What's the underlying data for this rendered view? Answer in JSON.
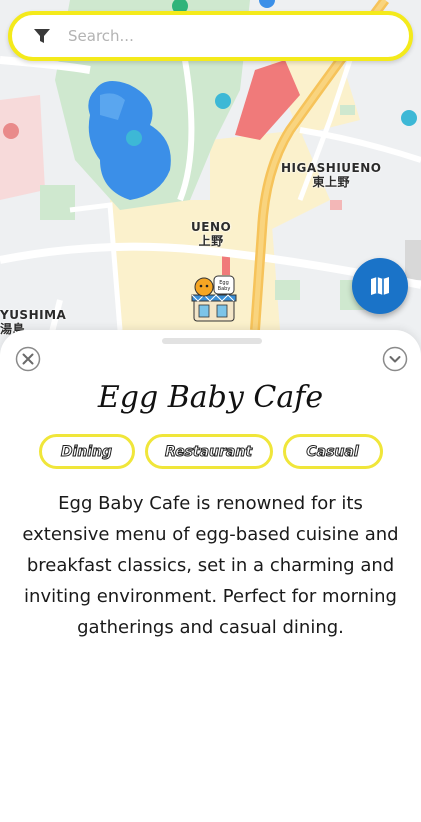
{
  "search": {
    "placeholder": "Search..."
  },
  "map": {
    "labels": {
      "higashiueno_en": "HIGASHIUENO",
      "higashiueno_jp": "東上野",
      "ueno_en": "UENO",
      "ueno_jp": "上野",
      "yushima_en": "YUSHIMA",
      "yushima_jp": "湯島"
    },
    "colors": {
      "park": "#cfe8cf",
      "water": "#3b8fe8",
      "road_major": "#f6c35a",
      "rail": "#f07a7a",
      "district": "#fbf1cc"
    }
  },
  "place": {
    "title": "Egg Baby Cafe",
    "pin_label": "Egg Baby",
    "tags": [
      "Dining",
      "Restaurant",
      "Casual"
    ],
    "description": "Egg Baby Cafe is renowned for its extensive menu of egg-based cuisine and breakfast classics, set in a charming and inviting environment. Perfect for morning gatherings and casual dining."
  },
  "icons": {
    "filter": "filter-icon",
    "map_toggle": "map-icon",
    "close": "close-icon",
    "collapse": "chevron-down-icon"
  },
  "colors": {
    "accent_yellow": "#f4ea1b",
    "fab_blue": "#1a73c8"
  }
}
